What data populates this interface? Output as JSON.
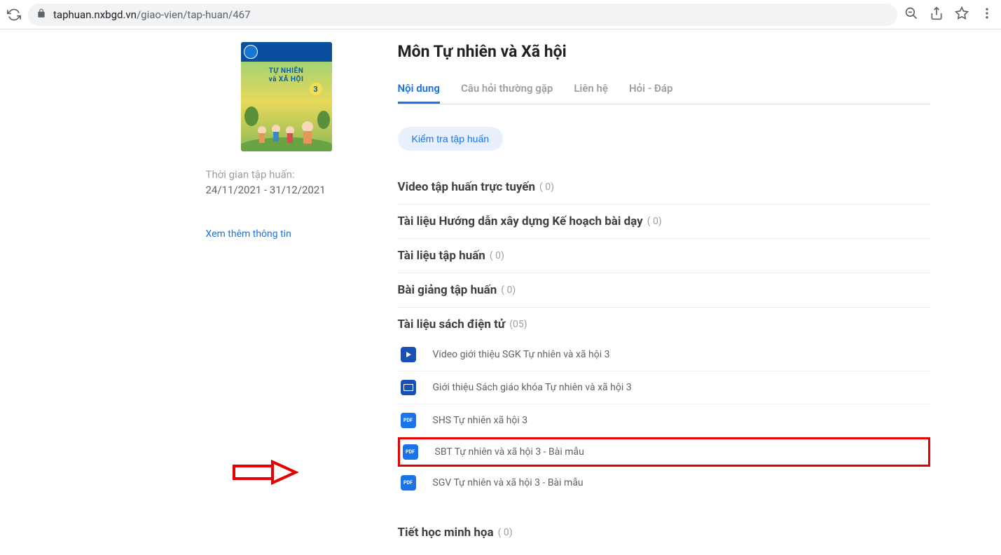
{
  "browser": {
    "url_domain": "taphuan.nxbgd.vn",
    "url_path": "/giao-vien/tap-huan/467"
  },
  "sidebar": {
    "book_title_line1": "TỰ NHIÊN",
    "book_title_line2": "và XÃ HỘI",
    "book_number": "3",
    "training_time_label": "Thời gian tập huấn:",
    "training_time_value": "24/11/2021 - 31/12/2021",
    "view_more": "Xem thêm thông tin"
  },
  "main": {
    "title": "Môn Tự nhiên và Xã hội",
    "tabs": [
      {
        "label": "Nội dung",
        "active": true
      },
      {
        "label": "Câu hỏi thường gặp",
        "active": false
      },
      {
        "label": "Liên hệ",
        "active": false
      },
      {
        "label": "Hỏi - Đáp",
        "active": false
      }
    ],
    "check_training_label": "Kiểm tra tập huấn",
    "sections": [
      {
        "title": "Video tập huấn trực tuyến",
        "count": "( 0)"
      },
      {
        "title": "Tài liệu Hướng dẫn xây dựng Kế hoạch bài dạy",
        "count": "( 0)"
      },
      {
        "title": "Tài liệu tập huấn",
        "count": "( 0)"
      },
      {
        "title": "Bài giảng tập huấn",
        "count": "( 0)"
      },
      {
        "title": "Tài liệu sách điện tử",
        "count": "(05)"
      },
      {
        "title": "Tiết học minh họa",
        "count": "( 0)"
      }
    ],
    "resources": [
      {
        "type": "video",
        "name": "Video giới thiệu SGK Tự nhiên và xã hội 3"
      },
      {
        "type": "slide",
        "name": "Giới thiệu Sách giáo khóa Tự nhiên và xã hội 3"
      },
      {
        "type": "pdf",
        "name": "SHS Tự nhiên xã hội 3"
      },
      {
        "type": "pdf",
        "name": "SBT Tự nhiên và xã hội 3 - Bài mẫu"
      },
      {
        "type": "pdf",
        "name": "SGV Tự nhiên và xã hội 3 - Bài mẫu"
      }
    ]
  }
}
